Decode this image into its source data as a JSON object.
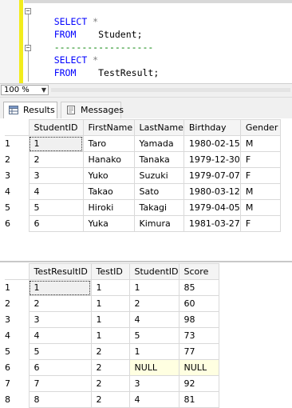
{
  "editor": {
    "lines": [
      {
        "kw": "SELECT",
        "rest": " *"
      },
      {
        "kw": "FROM",
        "rest": "    Student;"
      },
      {
        "comment": "------------------"
      },
      {
        "kw": "SELECT",
        "rest": " *"
      },
      {
        "kw": "FROM",
        "rest": "    TestResult;"
      }
    ]
  },
  "zoom": {
    "value": "100 %"
  },
  "tabs": {
    "results": "Results",
    "messages": "Messages"
  },
  "student_grid": {
    "headers": [
      "StudentID",
      "FirstName",
      "LastName",
      "Birthday",
      "Gender"
    ],
    "rows": [
      {
        "n": "1",
        "cells": [
          "1",
          "Taro",
          "Yamada",
          "1980-02-15",
          "M"
        ]
      },
      {
        "n": "2",
        "cells": [
          "2",
          "Hanako",
          "Tanaka",
          "1979-12-30",
          "F"
        ]
      },
      {
        "n": "3",
        "cells": [
          "3",
          "Yuko",
          "Suzuki",
          "1979-07-07",
          "F"
        ]
      },
      {
        "n": "4",
        "cells": [
          "4",
          "Takao",
          "Sato",
          "1980-03-12",
          "M"
        ]
      },
      {
        "n": "5",
        "cells": [
          "5",
          "Hiroki",
          "Takagi",
          "1979-04-05",
          "M"
        ]
      },
      {
        "n": "6",
        "cells": [
          "6",
          "Yuka",
          "Kimura",
          "1981-03-27",
          "F"
        ]
      }
    ]
  },
  "testresult_grid": {
    "headers": [
      "TestResultID",
      "TestID",
      "StudentID",
      "Score"
    ],
    "rows": [
      {
        "n": "1",
        "cells": [
          "1",
          "1",
          "1",
          "85"
        ]
      },
      {
        "n": "2",
        "cells": [
          "2",
          "1",
          "2",
          "60"
        ]
      },
      {
        "n": "3",
        "cells": [
          "3",
          "1",
          "4",
          "98"
        ]
      },
      {
        "n": "4",
        "cells": [
          "4",
          "1",
          "5",
          "73"
        ]
      },
      {
        "n": "5",
        "cells": [
          "5",
          "2",
          "1",
          "77"
        ]
      },
      {
        "n": "6",
        "cells": [
          "6",
          "2",
          "NULL",
          "NULL"
        ]
      },
      {
        "n": "7",
        "cells": [
          "7",
          "2",
          "3",
          "92"
        ]
      },
      {
        "n": "8",
        "cells": [
          "8",
          "2",
          "4",
          "81"
        ]
      }
    ]
  }
}
